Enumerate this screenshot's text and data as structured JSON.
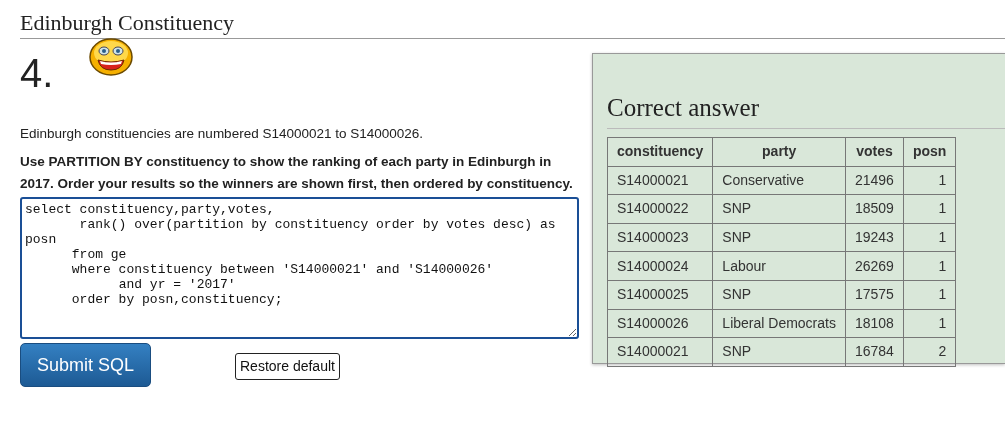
{
  "page_title": "Edinburgh Constituency",
  "question": {
    "number": "4.",
    "intro": "Edinburgh constituencies are numbered S14000021 to S14000026.",
    "instruction": "Use PARTITION BY constituency to show the ranking of each party in Edinburgh in 2017. Order your results so the winners are shown first, then ordered by constituency.",
    "sql": "select constituency,party,votes,\n       rank() over(partition by constituency order by votes desc) as posn\n      from ge\n      where constituency between 'S14000021' and 'S14000026'\n            and yr = '2017'\n      order by posn,constituency;",
    "buttons": [
      {
        "label": "Submit SQL",
        "kind": "primary"
      },
      {
        "label": "Restore default",
        "kind": "plain"
      }
    ]
  },
  "answer": {
    "title": "Correct answer",
    "table": {
      "columns": [
        "constituency",
        "party",
        "votes",
        "posn"
      ],
      "rows": [
        [
          "S14000021",
          "Conservative",
          "21496",
          "1"
        ],
        [
          "S14000022",
          "SNP",
          "18509",
          "1"
        ],
        [
          "S14000023",
          "SNP",
          "19243",
          "1"
        ],
        [
          "S14000024",
          "Labour",
          "26269",
          "1"
        ],
        [
          "S14000025",
          "SNP",
          "17575",
          "1"
        ],
        [
          "S14000026",
          "Liberal Democrats",
          "18108",
          "1"
        ],
        [
          "S14000021",
          "SNP",
          "16784",
          "2"
        ]
      ]
    }
  }
}
